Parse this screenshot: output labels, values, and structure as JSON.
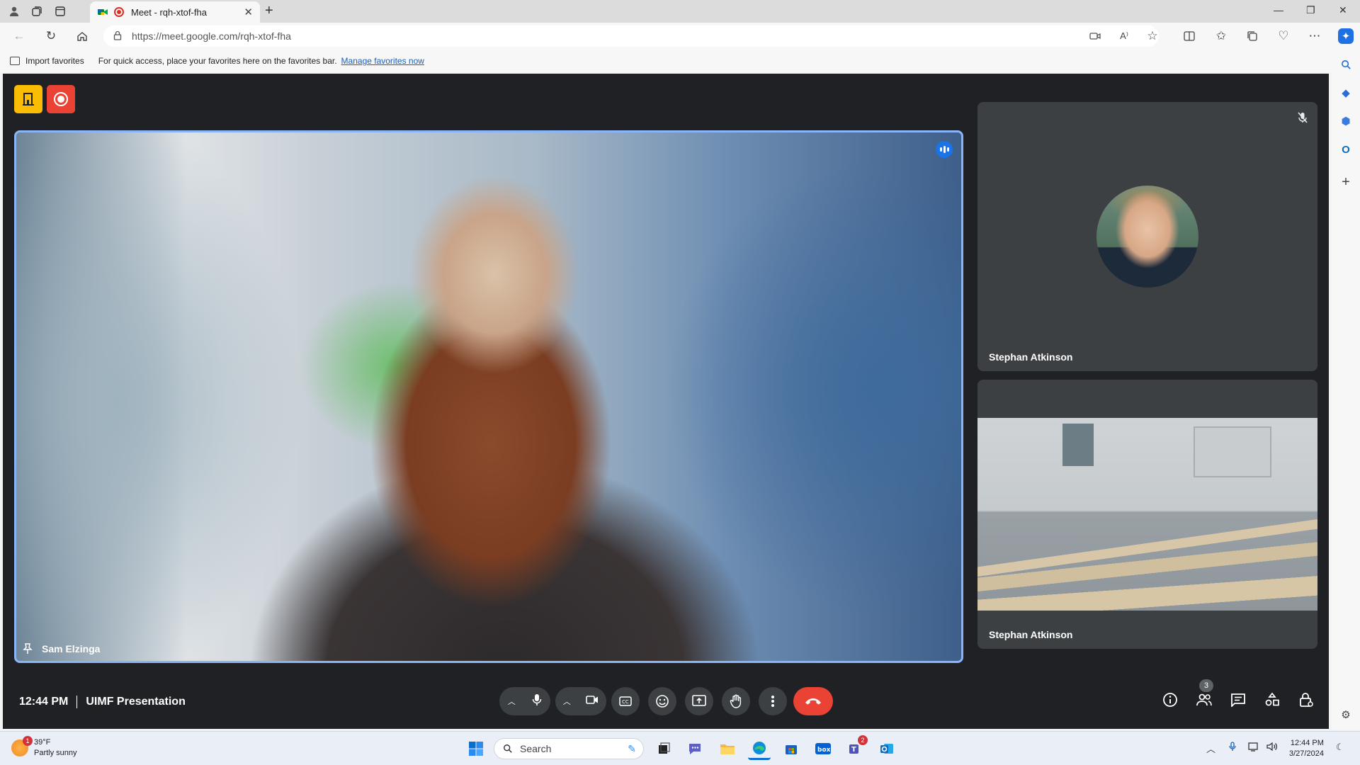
{
  "browser": {
    "tab": {
      "title": "Meet - rqh-xtof-fha"
    },
    "url": "https://meet.google.com/rqh-xtof-fha",
    "favorites_bar": {
      "import_label": "Import favorites",
      "message": "For quick access, place your favorites here on the favorites bar.",
      "manage_link": "Manage favorites now"
    }
  },
  "meeting": {
    "time": "12:44 PM",
    "title": "UIMF Presentation",
    "participant_count": "3",
    "main_speaker": {
      "name": "Sam Elzinga"
    },
    "side_tiles": [
      {
        "name": "Stephan Atkinson",
        "type": "avatar",
        "muted": true
      },
      {
        "name": "Stephan Atkinson",
        "type": "video"
      }
    ]
  },
  "taskbar": {
    "weather": {
      "temp": "39°F",
      "condition": "Partly sunny",
      "badge": "1"
    },
    "search_placeholder": "Search",
    "teams_badge": "2",
    "clock": {
      "time": "12:44 PM",
      "date": "3/27/2024"
    }
  },
  "colors": {
    "meet_bg": "#202124",
    "tile_bg": "#3c4043",
    "active_border": "#8ab4f8",
    "end_call": "#ea4335",
    "link": "#1a5fb4"
  }
}
